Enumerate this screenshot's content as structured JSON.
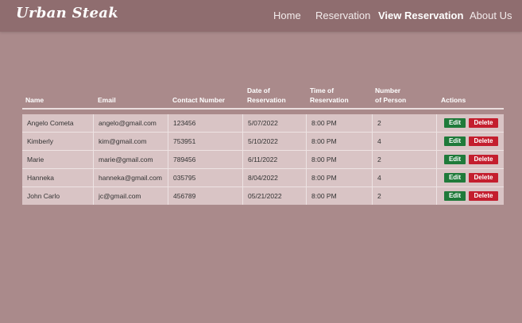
{
  "brand": "Urban Steak",
  "nav": [
    {
      "label": "Home",
      "active": false
    },
    {
      "label": "Reservation",
      "active": false
    },
    {
      "label": "View Reservation",
      "active": true
    },
    {
      "label": "About Us",
      "active": false
    }
  ],
  "table": {
    "headers": {
      "name": "Name",
      "email": "Email",
      "contact": "Contact Number",
      "date_l1": "Date of",
      "date_l2": "Reservation",
      "time_l1": "Time of",
      "time_l2": "Reservation",
      "persons_l1": "Number",
      "persons_l2": "of Person",
      "actions": "Actions"
    },
    "edit_label": "Edit",
    "delete_label": "Delete",
    "rows": [
      {
        "name": "Angelo Cometa",
        "email": "angelo@gmail.com",
        "contact": "123456",
        "date": "5/07/2022",
        "time": "8:00 PM",
        "persons": "2"
      },
      {
        "name": "Kimberly",
        "email": "kim@gmail.com",
        "contact": "753951",
        "date": "5/10/2022",
        "time": "8:00 PM",
        "persons": "4"
      },
      {
        "name": "Marie",
        "email": "marie@gmail.com",
        "contact": "789456",
        "date": "6/11/2022",
        "time": "8:00 PM",
        "persons": "2"
      },
      {
        "name": "Hanneka",
        "email": "hanneka@gmail.com",
        "contact": "035795",
        "date": "8/04/2022",
        "time": "8:00 PM",
        "persons": "4"
      },
      {
        "name": "John Carlo",
        "email": "jc@gmail.com",
        "contact": "456789",
        "date": "05/21/2022",
        "time": "8:00 PM",
        "persons": "2"
      }
    ]
  },
  "colors": {
    "page_bg": "#aa8a8b",
    "navbar_bg": "#8f6d6f",
    "table_body_bg": "#d9c4c5",
    "edit_button": "#1f7a3a",
    "delete_button": "#c41e2e"
  }
}
